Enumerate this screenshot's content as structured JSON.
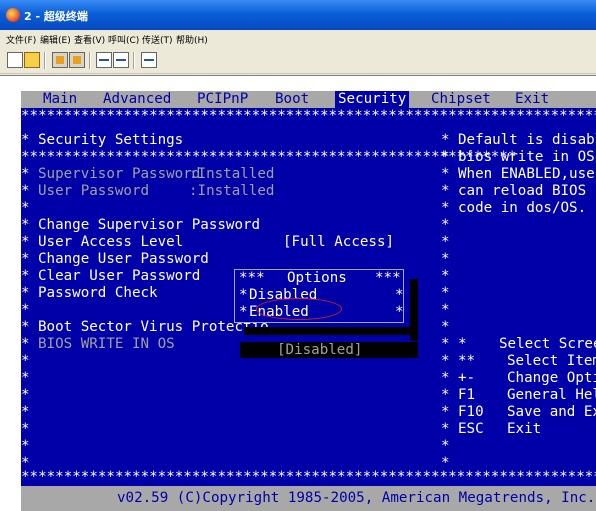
{
  "window": {
    "title": "2 - 超级终端"
  },
  "menubar": {
    "items": [
      "文件(F)",
      "编辑(E)",
      "查看(V)",
      "呼叫(C)",
      "传送(T)",
      "帮助(H)"
    ]
  },
  "toolbar": {
    "buttons": [
      "new-icon",
      "open-icon",
      "phone-icon",
      "disconnect-icon",
      "send-icon",
      "receive-icon",
      "properties-icon"
    ]
  },
  "bios": {
    "tabs": [
      "Main",
      "Advanced",
      "PCIPnP",
      "Boot",
      "Security",
      "Chipset",
      "Exit"
    ],
    "active_tab": "Security",
    "section_title": "Security Settings",
    "supervisor_password_label": "Supervisor Password",
    "supervisor_password_value": ":Installed",
    "user_password_label": "User Password",
    "user_password_value": ":Installed",
    "items": [
      "Change Supervisor Password",
      "User Access Level",
      "Change User Password",
      "Clear User Password",
      "Password Check",
      "Boot Sector Virus Protectio",
      "BIOS WRITE IN OS"
    ],
    "user_access_level_value": "[Full Access]",
    "bios_write_value": "[Disabled]",
    "help_text": [
      "Default is disable",
      "bios write in OS.",
      "When ENABLED,user",
      "can reload BIOS",
      "code in dos/OS."
    ],
    "keys": [
      {
        "key": "",
        "desc": "Select Screen"
      },
      {
        "key": "",
        "desc": "Select Item"
      },
      {
        "key": "+-",
        "desc": "Change Option"
      },
      {
        "key": "F1",
        "desc": "General Help"
      },
      {
        "key": "F10",
        "desc": "Save and Exit"
      },
      {
        "key": "ESC",
        "desc": "Exit"
      }
    ],
    "popup": {
      "title": "Options",
      "options": [
        "Disabled",
        "Enabled"
      ],
      "selected": "Enabled"
    },
    "footer": "v02.59 (C)Copyright 1985-2005, American Megatrends, Inc."
  },
  "colors": {
    "bios_background": "#0000a8",
    "bios_bar": "#a8a8a8",
    "highlight_ellipse": "#d02020"
  }
}
